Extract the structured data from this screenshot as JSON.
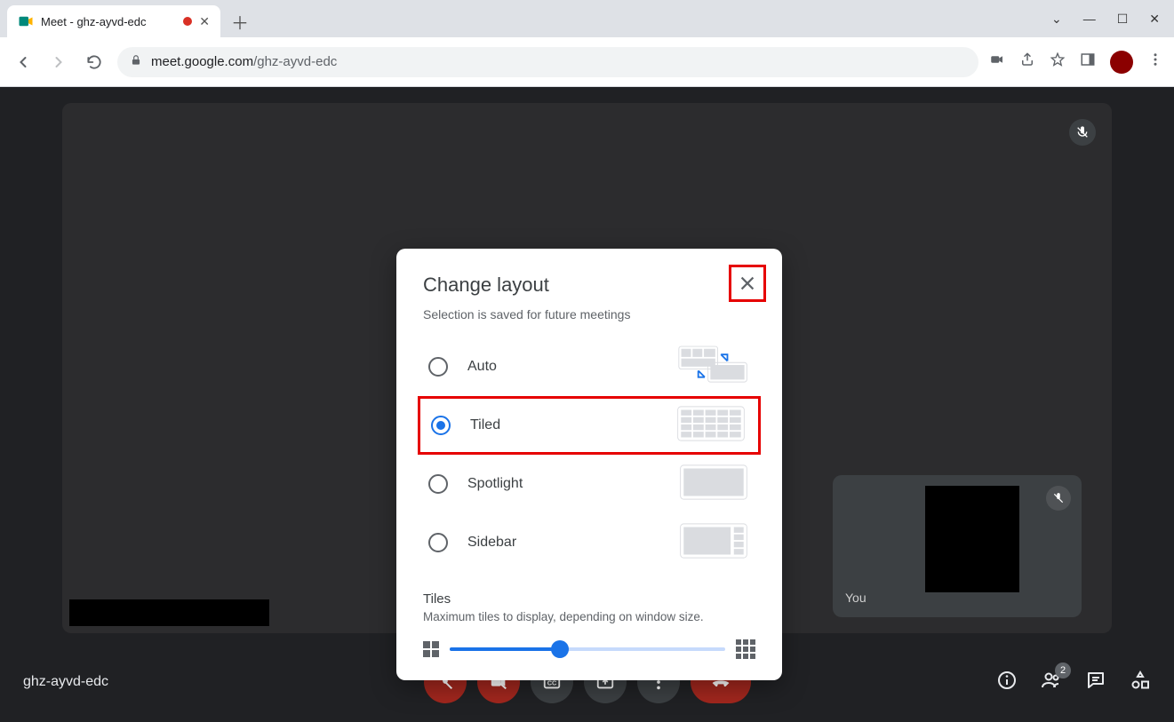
{
  "browser": {
    "tab_title": "Meet - ghz-ayvd-edc",
    "url_domain": "meet.google.com",
    "url_path": "/ghz-ayvd-edc"
  },
  "meet": {
    "meeting_code": "ghz-ayvd-edc",
    "self_label": "You",
    "participant_count": "2"
  },
  "dialog": {
    "title": "Change layout",
    "subtitle": "Selection is saved for future meetings",
    "options": [
      {
        "label": "Auto",
        "selected": false
      },
      {
        "label": "Tiled",
        "selected": true
      },
      {
        "label": "Spotlight",
        "selected": false
      },
      {
        "label": "Sidebar",
        "selected": false
      }
    ],
    "tiles_heading": "Tiles",
    "tiles_desc": "Maximum tiles to display, depending on window size.",
    "slider_value_percent": 40
  }
}
